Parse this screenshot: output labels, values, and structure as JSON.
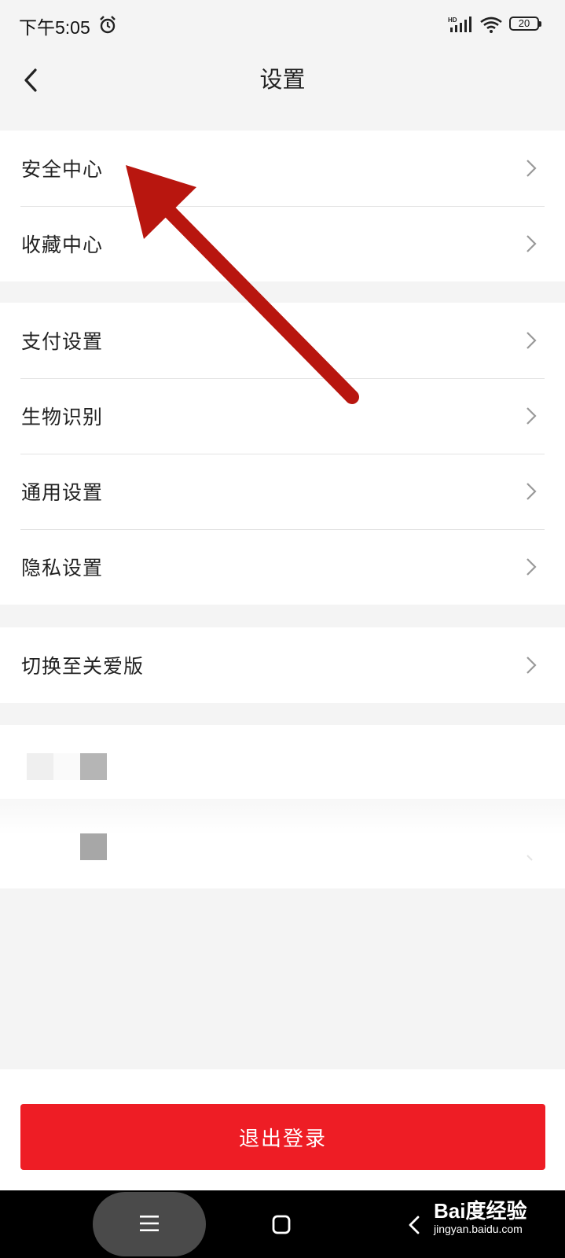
{
  "status_bar": {
    "time": "下午5:05",
    "battery_level": "20",
    "icons": [
      "alarm-icon",
      "hd-signal-icon",
      "wifi-icon",
      "battery-icon"
    ]
  },
  "header": {
    "title": "设置",
    "back_icon": "chevron-left-icon"
  },
  "groups": [
    {
      "items": [
        {
          "label": "安全中心"
        },
        {
          "label": "收藏中心"
        }
      ]
    },
    {
      "items": [
        {
          "label": "支付设置"
        },
        {
          "label": "生物识别"
        },
        {
          "label": "通用设置"
        },
        {
          "label": "隐私设置"
        }
      ]
    },
    {
      "items": [
        {
          "label": "切换至关爱版"
        }
      ]
    }
  ],
  "logout": {
    "label": "退出登录",
    "color": "#ee1d25"
  },
  "nav_bar": {
    "icons": [
      "menu-icon",
      "home-square-icon",
      "back-triangle-icon"
    ]
  },
  "watermark": {
    "brand": "Bai度经验",
    "url": "jingyan.baidu.com"
  },
  "annotation": {
    "arrow_color": "#b8160f"
  }
}
